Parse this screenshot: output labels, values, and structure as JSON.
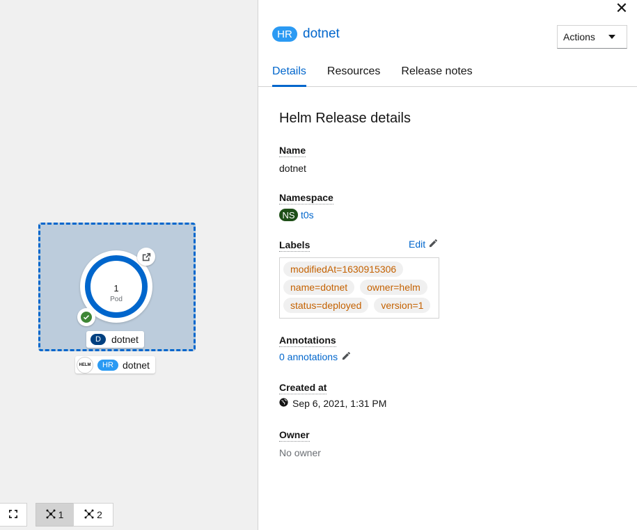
{
  "topology": {
    "pod_count": "1",
    "pod_label": "Pod",
    "deployment_badge": "D",
    "deployment_name": "dotnet",
    "helm_icon_text": "HELM",
    "release_badge": "HR",
    "release_name": "dotnet",
    "toolbar": {
      "layout1_label": "1",
      "layout2_label": "2"
    }
  },
  "panel": {
    "badge": "HR",
    "title": "dotnet",
    "actions_label": "Actions",
    "close_glyph": "✕",
    "tabs": [
      {
        "label": "Details",
        "active": true
      },
      {
        "label": "Resources",
        "active": false
      },
      {
        "label": "Release notes",
        "active": false
      }
    ],
    "section_title": "Helm Release details",
    "fields": {
      "name_label": "Name",
      "name_value": "dotnet",
      "namespace_label": "Namespace",
      "namespace_badge": "NS",
      "namespace_value": "t0s",
      "labels_label": "Labels",
      "labels_edit": "Edit",
      "labels": [
        "modifiedAt=1630915306",
        "name=dotnet",
        "owner=helm",
        "status=deployed",
        "version=1"
      ],
      "annotations_label": "Annotations",
      "annotations_value": "0 annotations",
      "created_label": "Created at",
      "created_value": "Sep 6, 2021, 1:31 PM",
      "owner_label": "Owner",
      "owner_value": "No owner"
    }
  },
  "colors": {
    "accent": "#0066cc",
    "hr_badge": "#2b9af3",
    "ns_badge": "#1e4f18",
    "label_chip_text": "#c46100",
    "status_ok": "#3e8635"
  },
  "icons": [
    "external-link-icon",
    "check-circle-icon",
    "helm-icon",
    "expand-icon",
    "topology-icon",
    "close-icon",
    "caret-down-icon",
    "pencil-icon",
    "globe-icon"
  ]
}
